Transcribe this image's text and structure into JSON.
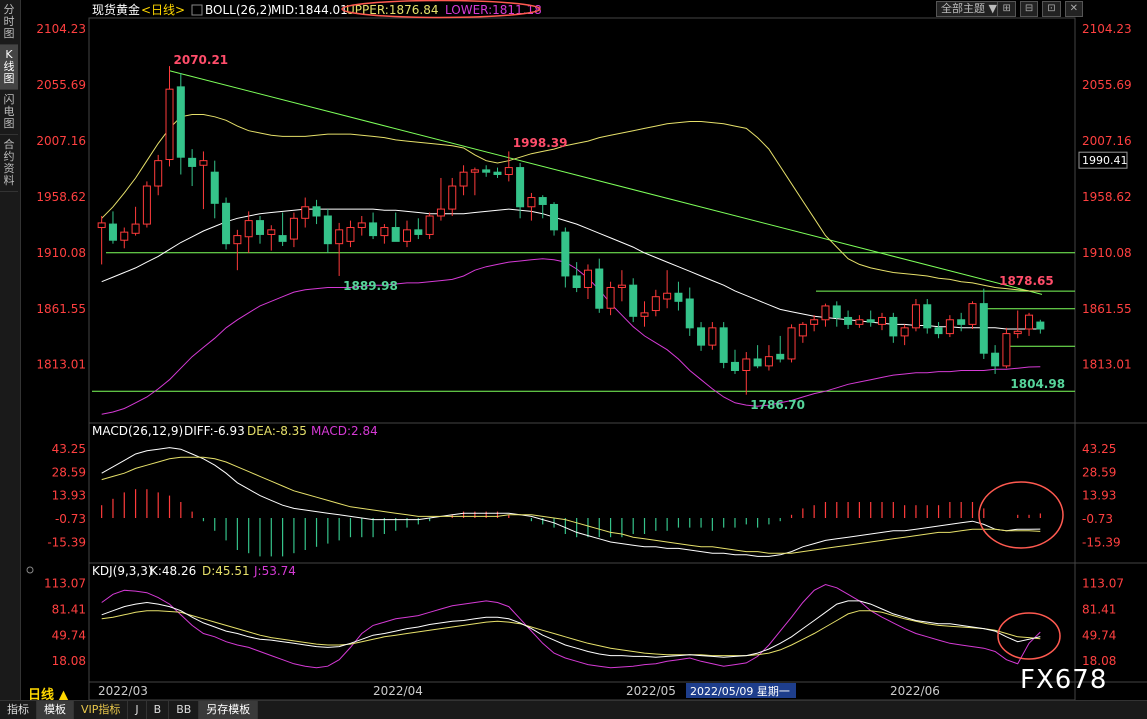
{
  "left_tabs": [
    {
      "label": "分时图",
      "active": false
    },
    {
      "label": "K线图",
      "active": true
    },
    {
      "label": "闪电图",
      "active": false
    },
    {
      "label": "合约资料",
      "active": false
    }
  ],
  "header": {
    "instrument": "现货黄金",
    "period_tag": "<日线>",
    "indicator": "BOLL(26,2)",
    "mid": "MID:1844.01",
    "upper": "UPPER:1876.84",
    "lower": "LOWER:1811.18",
    "theme_btn": "全部主题",
    "theme_arrow": "▼"
  },
  "window_buttons": [
    "⊞",
    "⊟",
    "⊡",
    "✕"
  ],
  "colors": {
    "up": "#ff3b3b",
    "down": "#35c38a",
    "mid": "#ffffff",
    "upper": "#e6e06a",
    "lower": "#d53ad5",
    "axis_text": "#ff4040",
    "grid_line": "#7dff5a",
    "trend": "#7dff5a",
    "annot_high": "#ff4d6a",
    "annot_low": "#56d49a",
    "circle": "#ff5a50",
    "logo": "#ffffff"
  },
  "price_axis": {
    "ticks": [
      "2104.23",
      "2055.69",
      "2007.16",
      "1958.62",
      "1910.08",
      "1861.55",
      "1813.01"
    ]
  },
  "price_readout": "1990.41",
  "price_annotations": [
    {
      "label": "2070.21",
      "kind": "high"
    },
    {
      "label": "1998.39",
      "kind": "high"
    },
    {
      "label": "1889.98",
      "kind": "low"
    },
    {
      "label": "1786.70",
      "kind": "low"
    },
    {
      "label": "1878.65",
      "kind": "high"
    },
    {
      "label": "1804.98",
      "kind": "low"
    }
  ],
  "macd_header": {
    "name": "MACD(26,12,9)",
    "diff": "DIFF:-6.93",
    "dea": "DEA:-8.35",
    "macd": "MACD:2.84"
  },
  "macd_axis": {
    "ticks": [
      "43.25",
      "28.59",
      "13.93",
      "-0.73",
      "-15.39"
    ]
  },
  "kdj_header": {
    "name": "KDJ(9,3,3)",
    "k": "K:48.26",
    "d": "D:45.51",
    "j": "J:53.74"
  },
  "kdj_axis": {
    "ticks": [
      "113.07",
      "81.41",
      "49.74",
      "18.08"
    ]
  },
  "date_axis": [
    "2022/03",
    "2022/04",
    "2022/05",
    "2022/06"
  ],
  "crosshair_date": "2022/05/09 星期一",
  "period_label": "日线 ▲",
  "bottom_buttons": [
    {
      "label": "指标",
      "active": false,
      "vip": false
    },
    {
      "label": "模板",
      "active": true,
      "vip": false
    },
    {
      "label": "VIP指标",
      "active": false,
      "vip": true
    },
    {
      "label": "J",
      "active": false,
      "vip": false
    },
    {
      "label": "B",
      "active": false,
      "vip": false
    },
    {
      "label": "BB",
      "active": false,
      "vip": false
    },
    {
      "label": "另存模板",
      "active": true,
      "vip": false
    }
  ],
  "logo": "FX678",
  "chart_data": {
    "type": "candlestick",
    "title": "现货黄金 <日线>",
    "ylim": [
      1772,
      2112
    ],
    "candles": [
      {
        "o": 1932,
        "h": 1942,
        "l": 1900,
        "c": 1936
      },
      {
        "o": 1935,
        "h": 1946,
        "l": 1918,
        "c": 1921
      },
      {
        "o": 1921,
        "h": 1932,
        "l": 1914,
        "c": 1928
      },
      {
        "o": 1927,
        "h": 1950,
        "l": 1925,
        "c": 1935
      },
      {
        "o": 1935,
        "h": 1972,
        "l": 1932,
        "c": 1968
      },
      {
        "o": 1968,
        "h": 1995,
        "l": 1960,
        "c": 1990
      },
      {
        "o": 1991,
        "h": 2072,
        "l": 1985,
        "c": 2052
      },
      {
        "o": 2054,
        "h": 2066,
        "l": 1978,
        "c": 1993
      },
      {
        "o": 1992,
        "h": 2000,
        "l": 1968,
        "c": 1985
      },
      {
        "o": 1986,
        "h": 1998,
        "l": 1948,
        "c": 1990
      },
      {
        "o": 1980,
        "h": 1990,
        "l": 1940,
        "c": 1953
      },
      {
        "o": 1953,
        "h": 1958,
        "l": 1913,
        "c": 1918
      },
      {
        "o": 1918,
        "h": 1930,
        "l": 1895,
        "c": 1925
      },
      {
        "o": 1924,
        "h": 1946,
        "l": 1910,
        "c": 1938
      },
      {
        "o": 1938,
        "h": 1942,
        "l": 1918,
        "c": 1926
      },
      {
        "o": 1926,
        "h": 1934,
        "l": 1912,
        "c": 1930
      },
      {
        "o": 1925,
        "h": 1945,
        "l": 1916,
        "c": 1920
      },
      {
        "o": 1922,
        "h": 1945,
        "l": 1915,
        "c": 1940
      },
      {
        "o": 1940,
        "h": 1958,
        "l": 1932,
        "c": 1950
      },
      {
        "o": 1950,
        "h": 1956,
        "l": 1935,
        "c": 1942
      },
      {
        "o": 1942,
        "h": 1948,
        "l": 1910,
        "c": 1918
      },
      {
        "o": 1918,
        "h": 1936,
        "l": 1890,
        "c": 1930
      },
      {
        "o": 1920,
        "h": 1938,
        "l": 1915,
        "c": 1932
      },
      {
        "o": 1932,
        "h": 1942,
        "l": 1925,
        "c": 1936
      },
      {
        "o": 1936,
        "h": 1945,
        "l": 1922,
        "c": 1925
      },
      {
        "o": 1925,
        "h": 1935,
        "l": 1918,
        "c": 1932
      },
      {
        "o": 1932,
        "h": 1945,
        "l": 1925,
        "c": 1920
      },
      {
        "o": 1920,
        "h": 1938,
        "l": 1915,
        "c": 1930
      },
      {
        "o": 1930,
        "h": 1940,
        "l": 1922,
        "c": 1926
      },
      {
        "o": 1926,
        "h": 1945,
        "l": 1922,
        "c": 1942
      },
      {
        "o": 1942,
        "h": 1975,
        "l": 1938,
        "c": 1948
      },
      {
        "o": 1948,
        "h": 1975,
        "l": 1942,
        "c": 1968
      },
      {
        "o": 1968,
        "h": 1986,
        "l": 1960,
        "c": 1980
      },
      {
        "o": 1980,
        "h": 1984,
        "l": 1960,
        "c": 1982
      },
      {
        "o": 1982,
        "h": 1986,
        "l": 1976,
        "c": 1980
      },
      {
        "o": 1980,
        "h": 1984,
        "l": 1975,
        "c": 1978
      },
      {
        "o": 1978,
        "h": 1998,
        "l": 1972,
        "c": 1984
      },
      {
        "o": 1984,
        "h": 1988,
        "l": 1940,
        "c": 1950
      },
      {
        "o": 1950,
        "h": 1962,
        "l": 1938,
        "c": 1958
      },
      {
        "o": 1958,
        "h": 1960,
        "l": 1940,
        "c": 1952
      },
      {
        "o": 1952,
        "h": 1954,
        "l": 1925,
        "c": 1930
      },
      {
        "o": 1928,
        "h": 1932,
        "l": 1880,
        "c": 1890
      },
      {
        "o": 1890,
        "h": 1902,
        "l": 1876,
        "c": 1880
      },
      {
        "o": 1880,
        "h": 1900,
        "l": 1870,
        "c": 1895
      },
      {
        "o": 1896,
        "h": 1905,
        "l": 1858,
        "c": 1862
      },
      {
        "o": 1862,
        "h": 1885,
        "l": 1856,
        "c": 1880
      },
      {
        "o": 1880,
        "h": 1895,
        "l": 1868,
        "c": 1882
      },
      {
        "o": 1882,
        "h": 1888,
        "l": 1850,
        "c": 1855
      },
      {
        "o": 1855,
        "h": 1868,
        "l": 1846,
        "c": 1858
      },
      {
        "o": 1860,
        "h": 1878,
        "l": 1855,
        "c": 1872
      },
      {
        "o": 1870,
        "h": 1895,
        "l": 1862,
        "c": 1875
      },
      {
        "o": 1875,
        "h": 1885,
        "l": 1860,
        "c": 1868
      },
      {
        "o": 1870,
        "h": 1880,
        "l": 1838,
        "c": 1845
      },
      {
        "o": 1845,
        "h": 1850,
        "l": 1825,
        "c": 1830
      },
      {
        "o": 1830,
        "h": 1850,
        "l": 1826,
        "c": 1845
      },
      {
        "o": 1845,
        "h": 1850,
        "l": 1810,
        "c": 1815
      },
      {
        "o": 1815,
        "h": 1826,
        "l": 1805,
        "c": 1808
      },
      {
        "o": 1808,
        "h": 1824,
        "l": 1787,
        "c": 1818
      },
      {
        "o": 1818,
        "h": 1830,
        "l": 1810,
        "c": 1812
      },
      {
        "o": 1812,
        "h": 1830,
        "l": 1808,
        "c": 1820
      },
      {
        "o": 1822,
        "h": 1838,
        "l": 1815,
        "c": 1818
      },
      {
        "o": 1818,
        "h": 1848,
        "l": 1815,
        "c": 1845
      },
      {
        "o": 1838,
        "h": 1850,
        "l": 1832,
        "c": 1848
      },
      {
        "o": 1848,
        "h": 1856,
        "l": 1842,
        "c": 1852
      },
      {
        "o": 1852,
        "h": 1866,
        "l": 1846,
        "c": 1864
      },
      {
        "o": 1864,
        "h": 1868,
        "l": 1846,
        "c": 1854
      },
      {
        "o": 1854,
        "h": 1860,
        "l": 1844,
        "c": 1848
      },
      {
        "o": 1848,
        "h": 1856,
        "l": 1845,
        "c": 1852
      },
      {
        "o": 1852,
        "h": 1860,
        "l": 1846,
        "c": 1850
      },
      {
        "o": 1848,
        "h": 1858,
        "l": 1843,
        "c": 1854
      },
      {
        "o": 1854,
        "h": 1858,
        "l": 1832,
        "c": 1838
      },
      {
        "o": 1838,
        "h": 1848,
        "l": 1830,
        "c": 1845
      },
      {
        "o": 1845,
        "h": 1870,
        "l": 1842,
        "c": 1865
      },
      {
        "o": 1865,
        "h": 1870,
        "l": 1840,
        "c": 1845
      },
      {
        "o": 1845,
        "h": 1850,
        "l": 1836,
        "c": 1840
      },
      {
        "o": 1840,
        "h": 1856,
        "l": 1837,
        "c": 1852
      },
      {
        "o": 1852,
        "h": 1858,
        "l": 1842,
        "c": 1848
      },
      {
        "o": 1848,
        "h": 1868,
        "l": 1844,
        "c": 1866
      },
      {
        "o": 1866,
        "h": 1879,
        "l": 1818,
        "c": 1823
      },
      {
        "o": 1823,
        "h": 1830,
        "l": 1805,
        "c": 1812
      },
      {
        "o": 1812,
        "h": 1845,
        "l": 1810,
        "c": 1840
      },
      {
        "o": 1840,
        "h": 1860,
        "l": 1836,
        "c": 1842
      },
      {
        "o": 1844,
        "h": 1858,
        "l": 1838,
        "c": 1856
      },
      {
        "o": 1850,
        "h": 1852,
        "l": 1840,
        "c": 1844
      }
    ],
    "boll_mid": [
      1885,
      1889,
      1893,
      1897,
      1902,
      1907,
      1913,
      1919,
      1924,
      1929,
      1933,
      1937,
      1940,
      1942,
      1944,
      1945,
      1946,
      1947,
      1948,
      1948,
      1948,
      1948,
      1948,
      1948,
      1948,
      1947,
      1947,
      1946,
      1945,
      1944,
      1944,
      1944,
      1944,
      1945,
      1946,
      1947,
      1948,
      1947,
      1946,
      1944,
      1941,
      1938,
      1935,
      1931,
      1927,
      1923,
      1919,
      1915,
      1910,
      1906,
      1902,
      1898,
      1894,
      1890,
      1886,
      1882,
      1877,
      1873,
      1869,
      1865,
      1861,
      1859,
      1857,
      1855,
      1854,
      1853,
      1852,
      1851,
      1850,
      1849,
      1848,
      1848,
      1847,
      1847,
      1846,
      1846,
      1845,
      1845,
      1845,
      1845,
      1844,
      1844,
      1844,
      1844
    ],
    "boll_upper": [
      1940,
      1950,
      1962,
      1975,
      1990,
      2005,
      2018,
      2028,
      2030,
      2030,
      2028,
      2025,
      2020,
      2016,
      2014,
      2012,
      2011,
      2011,
      2011,
      2012,
      2013,
      2013,
      2013,
      2012,
      2011,
      2010,
      2008,
      2007,
      2006,
      2005,
      2004,
      2003,
      2001,
      1995,
      1990,
      1988,
      1990,
      1993,
      1996,
      1998,
      2000,
      2003,
      2005,
      2007,
      2010,
      2012,
      2014,
      2016,
      2018,
      2020,
      2022,
      2023,
      2024,
      2024,
      2023,
      2022,
      2020,
      2018,
      2010,
      2000,
      1985,
      1970,
      1955,
      1940,
      1925,
      1915,
      1905,
      1900,
      1897,
      1895,
      1893,
      1892,
      1891,
      1890,
      1888,
      1887,
      1885,
      1884,
      1882,
      1880,
      1879,
      1878,
      1877,
      1876.84
    ],
    "boll_lower": [
      1770,
      1772,
      1775,
      1780,
      1785,
      1792,
      1800,
      1810,
      1820,
      1828,
      1836,
      1845,
      1852,
      1858,
      1864,
      1868,
      1872,
      1876,
      1878,
      1879,
      1880,
      1880,
      1880,
      1881,
      1882,
      1882,
      1883,
      1884,
      1884,
      1885,
      1886,
      1887,
      1890,
      1895,
      1898,
      1900,
      1902,
      1903,
      1904,
      1905,
      1904,
      1902,
      1896,
      1888,
      1878,
      1866,
      1856,
      1846,
      1838,
      1832,
      1826,
      1818,
      1808,
      1800,
      1792,
      1785,
      1780,
      1778,
      1777,
      1778,
      1780,
      1782,
      1785,
      1788,
      1790,
      1793,
      1796,
      1798,
      1800,
      1802,
      1804,
      1805,
      1806,
      1806,
      1807,
      1807,
      1808,
      1808,
      1808,
      1809,
      1809,
      1810,
      1811,
      1811.18
    ],
    "annotations": [
      {
        "label": "2070.21",
        "index": 6,
        "price": 2070.21
      },
      {
        "label": "1998.39",
        "index": 36,
        "price": 1998.39
      },
      {
        "label": "1889.98",
        "index": 21,
        "price": 1889.98
      },
      {
        "label": "1786.70",
        "index": 57,
        "price": 1786.7
      },
      {
        "label": "1878.65",
        "index": 79,
        "price": 1878.65
      },
      {
        "label": "1804.98",
        "index": 80,
        "price": 1804.98
      }
    ],
    "macd": {
      "ylim": [
        -25,
        50
      ],
      "diff": [
        28,
        32,
        36,
        40,
        42,
        43,
        44,
        43,
        40,
        37,
        33,
        28,
        22,
        18,
        14,
        11,
        8,
        6,
        5,
        4,
        3,
        2,
        1,
        0,
        -1,
        -1,
        -1,
        -1,
        -1,
        0,
        1,
        2,
        3,
        3,
        3,
        3,
        3,
        2,
        1,
        -1,
        -3,
        -6,
        -9,
        -11,
        -13,
        -15,
        -16,
        -17,
        -18,
        -18,
        -19,
        -19,
        -20,
        -21,
        -22,
        -22,
        -23,
        -23,
        -24,
        -24,
        -23,
        -21,
        -18,
        -16,
        -14,
        -13,
        -12,
        -11,
        -10,
        -9,
        -8,
        -8,
        -7,
        -6,
        -5,
        -4,
        -3,
        -2,
        -4,
        -7,
        -8,
        -7,
        -7,
        -6.93
      ],
      "dea": [
        24,
        26,
        28,
        31,
        33,
        35,
        37,
        38,
        38,
        38,
        37,
        35,
        32,
        29,
        26,
        23,
        20,
        17,
        15,
        13,
        11,
        9,
        7,
        6,
        5,
        4,
        3,
        2,
        1,
        1,
        1,
        1,
        1,
        1,
        1,
        1,
        2,
        2,
        2,
        1,
        0,
        -1,
        -3,
        -5,
        -7,
        -9,
        -10,
        -12,
        -13,
        -14,
        -15,
        -16,
        -17,
        -18,
        -18,
        -19,
        -20,
        -21,
        -21,
        -22,
        -22,
        -22,
        -21,
        -20,
        -19,
        -18,
        -17,
        -16,
        -15,
        -14,
        -13,
        -12,
        -11,
        -10,
        -9,
        -9,
        -8,
        -7,
        -7,
        -7,
        -8,
        -8,
        -8,
        -8.35
      ]
    },
    "kdj": {
      "ylim": [
        0,
        120
      ],
      "k": [
        75,
        80,
        85,
        88,
        90,
        88,
        85,
        80,
        72,
        65,
        60,
        55,
        52,
        48,
        45,
        44,
        42,
        40,
        38,
        36,
        35,
        36,
        40,
        45,
        50,
        52,
        55,
        58,
        60,
        63,
        65,
        67,
        68,
        70,
        72,
        72,
        70,
        65,
        58,
        50,
        44,
        38,
        34,
        30,
        27,
        25,
        25,
        24,
        24,
        23,
        24,
        25,
        26,
        25,
        24,
        23,
        24,
        25,
        28,
        33,
        40,
        48,
        58,
        68,
        78,
        88,
        92,
        92,
        88,
        82,
        76,
        72,
        68,
        66,
        64,
        64,
        62,
        60,
        58,
        55,
        48,
        42,
        45,
        48.26
      ],
      "d": [
        70,
        72,
        75,
        78,
        80,
        80,
        79,
        78,
        74,
        70,
        66,
        62,
        58,
        54,
        50,
        47,
        45,
        43,
        41,
        39,
        38,
        38,
        39,
        42,
        45,
        48,
        50,
        52,
        54,
        56,
        58,
        60,
        62,
        64,
        66,
        67,
        66,
        64,
        60,
        56,
        52,
        48,
        44,
        40,
        37,
        34,
        32,
        30,
        28,
        27,
        26,
        26,
        26,
        26,
        25,
        25,
        25,
        25,
        26,
        28,
        32,
        38,
        45,
        52,
        60,
        68,
        76,
        80,
        80,
        78,
        74,
        70,
        67,
        64,
        62,
        61,
        60,
        59,
        58,
        56,
        52,
        48,
        47,
        45.51
      ],
      "j": [
        90,
        100,
        105,
        104,
        102,
        96,
        88,
        75,
        62,
        52,
        48,
        42,
        38,
        35,
        30,
        25,
        20,
        15,
        12,
        10,
        12,
        20,
        35,
        52,
        62,
        66,
        70,
        72,
        74,
        78,
        82,
        86,
        88,
        90,
        92,
        90,
        85,
        70,
        55,
        40,
        28,
        22,
        18,
        14,
        12,
        10,
        11,
        12,
        14,
        15,
        18,
        20,
        22,
        18,
        15,
        12,
        14,
        16,
        24,
        38,
        55,
        72,
        90,
        105,
        112,
        108,
        100,
        92,
        80,
        72,
        65,
        58,
        52,
        48,
        44,
        40,
        38,
        36,
        34,
        30,
        20,
        15,
        40,
        53.74
      ]
    }
  }
}
